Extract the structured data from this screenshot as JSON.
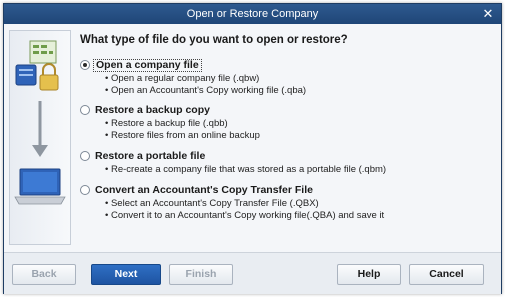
{
  "window": {
    "title": "Open or Restore Company"
  },
  "question": "What type of file do you want to open or restore?",
  "options": [
    {
      "label": "Open a company file",
      "selected": true,
      "bullets": [
        "Open a regular company file (.qbw)",
        "Open an Accountant's Copy working file (.qba)"
      ]
    },
    {
      "label": "Restore a backup copy",
      "selected": false,
      "bullets": [
        "Restore a backup file (.qbb)",
        "Restore files from an online backup"
      ]
    },
    {
      "label": "Restore a portable file",
      "selected": false,
      "bullets": [
        "Re-create a company file that was stored as a portable file (.qbm)"
      ]
    },
    {
      "label": "Convert an Accountant's Copy Transfer File",
      "selected": false,
      "bullets": [
        "Select an Accountant's Copy Transfer File (.QBX)",
        "Convert it to an Accountant's Copy working file(.QBA) and save it"
      ]
    }
  ],
  "buttons": {
    "back": "Back",
    "next": "Next",
    "finish": "Finish",
    "help": "Help",
    "cancel": "Cancel"
  },
  "icons": {
    "close": "close-icon",
    "illustration": "file-restore-illustration"
  },
  "colors": {
    "titlebar": "#1f4677",
    "primary_button": "#1e54a2",
    "panel_bg": "#f4f6f9"
  }
}
